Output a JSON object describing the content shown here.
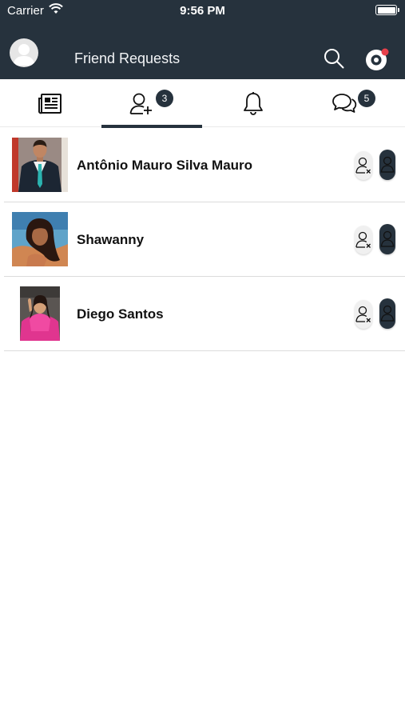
{
  "status_bar": {
    "carrier": "Carrier",
    "time": "9:56 PM"
  },
  "header": {
    "title": "Friend Requests",
    "icons": [
      "user-avatar",
      "search-icon",
      "settings-icon"
    ],
    "notification_dot_color": "#e8414b"
  },
  "tabs": [
    {
      "icon": "news-icon",
      "badge": ""
    },
    {
      "icon": "add-friend-icon",
      "badge": "3",
      "active": true
    },
    {
      "icon": "bell-icon",
      "badge": ""
    },
    {
      "icon": "chat-icon",
      "badge": "5"
    }
  ],
  "requests": [
    {
      "name": "Antônio Mauro Silva Mauro"
    },
    {
      "name": "Shawanny"
    },
    {
      "name": "Diego Santos"
    }
  ],
  "colors": {
    "primary_dark": "#26323d",
    "background": "#ffffff",
    "divider": "#dcdcdc"
  }
}
